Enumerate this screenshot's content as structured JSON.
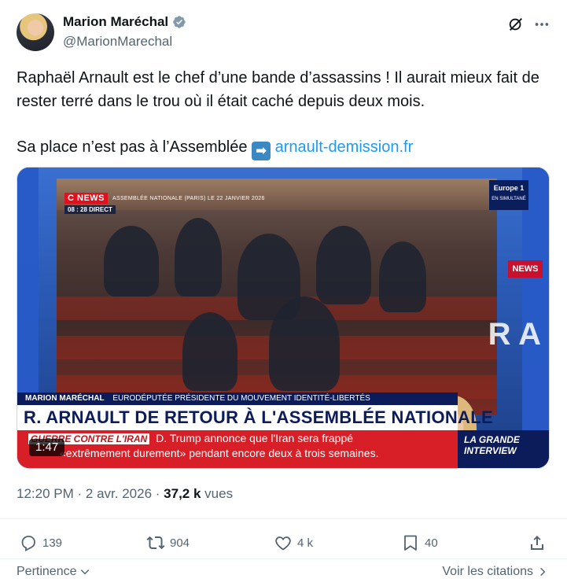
{
  "author": {
    "name": "Marion Maréchal",
    "handle": "@MarionMarechal",
    "verified": true
  },
  "post": {
    "line1": "Raphaël Arnault est le chef d’une bande d’assassins ! Il aurait mieux fait de rester terré dans le trou où il était caché depuis deux mois.",
    "line2_prefix": "Sa place n’est pas à l’Assemblée",
    "arrow_emoji": "➡",
    "link_text": "arnault-demission.fr"
  },
  "media": {
    "duration": "1:47",
    "channel_logo": "C NEWS",
    "channel_subtitle": "ASSEMBLÉE NATIONALE (PARIS) LE 22 JANVIER 2026",
    "live_badge": "08 : 28 DIRECT",
    "partner_logo": "Europe 1",
    "partner_sub": "EN SIMULTANÉ",
    "lower_third_name": "MARION MARÉCHAL",
    "lower_third_role": "EURODÉPUTÉE PRÉSIDENTE DU MOUVEMENT IDENTITÉ-LIBERTÉS",
    "headline": "R. ARNAULT DE RETOUR À L'ASSEMBLÉE NATIONALE",
    "ticker_tag": "GUERRE CONTRE L'IRAN",
    "ticker_line1": "D. Trump annonce que l'Iran sera frappé",
    "ticker_line2": "«extrêmement durement» pendant encore deux à trois semaines.",
    "program_name": "LA GRANDE INTERVIEW",
    "side_logo": "NEWS",
    "big_letter": "R A"
  },
  "meta": {
    "time": "12:20 PM",
    "dot1": "·",
    "date": "2 avr. 2026",
    "dot2": "·",
    "views_count": "37,2 k",
    "views_label": "vues"
  },
  "actions": {
    "replies": "139",
    "reposts": "904",
    "likes": "4 k",
    "bookmarks": "40"
  },
  "footer": {
    "sort_label": "Pertinence",
    "quotes_label": "Voir les citations"
  },
  "colors": {
    "link": "#1d9bf0",
    "secondary_text": "#536471",
    "verified_badge": "#829aab",
    "primary_text": "#0f1419"
  }
}
